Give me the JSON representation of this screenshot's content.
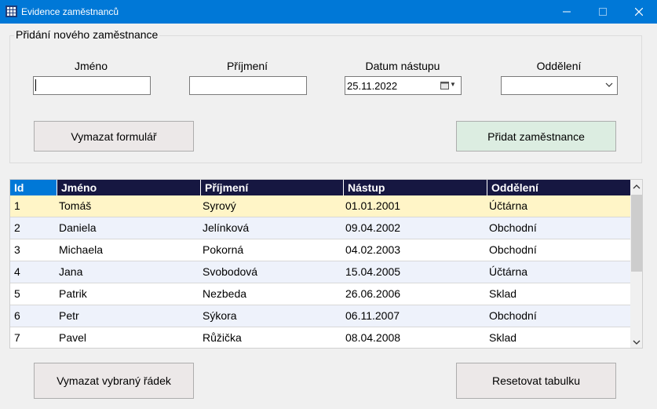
{
  "window": {
    "title": "Evidence zaměstnanců"
  },
  "form": {
    "group_title": "Přidání nového zaměstnance",
    "labels": {
      "first_name": "Jméno",
      "last_name": "Příjmení",
      "start_date": "Datum nástupu",
      "department": "Oddělení"
    },
    "values": {
      "first_name": "",
      "last_name": "",
      "start_date": "25.11.2022",
      "department": ""
    },
    "clear_button": "Vymazat formulář",
    "add_button": "Přidat zaměstnance"
  },
  "table": {
    "columns": [
      "Id",
      "Jméno",
      "Příjmení",
      "Nástup",
      "Oddělení"
    ],
    "rows": [
      [
        "1",
        "Tomáš",
        "Syrový",
        "01.01.2001",
        "Účtárna"
      ],
      [
        "2",
        "Daniela",
        "Jelínková",
        "09.04.2002",
        "Obchodní"
      ],
      [
        "3",
        "Michaela",
        "Pokorná",
        "04.02.2003",
        "Obchodní"
      ],
      [
        "4",
        "Jana",
        "Svobodová",
        "15.04.2005",
        "Účtárna"
      ],
      [
        "5",
        "Patrik",
        "Nezbeda",
        "26.06.2006",
        "Sklad"
      ],
      [
        "6",
        "Petr",
        "Sýkora",
        "06.11.2007",
        "Obchodní"
      ],
      [
        "7",
        "Pavel",
        "Růžička",
        "08.04.2008",
        "Sklad"
      ]
    ],
    "selected_row": 0
  },
  "buttons": {
    "delete_row": "Vymazat vybraný řádek",
    "reset_table": "Resetovat tabulku"
  },
  "colors": {
    "titlebar": "#0078d7",
    "header_bg": "#161741",
    "header_first": "#0078d7",
    "row_selected": "#fff5c7",
    "row_alt": "#eef2fb",
    "row_plain": "#ffffff",
    "add_button_bg": "#dcede1"
  },
  "icons": [
    "app-icon",
    "minimize-icon",
    "maximize-icon",
    "close-icon",
    "calendar-icon",
    "dropdown-chevron-icon",
    "scroll-up-icon",
    "scroll-down-icon"
  ]
}
